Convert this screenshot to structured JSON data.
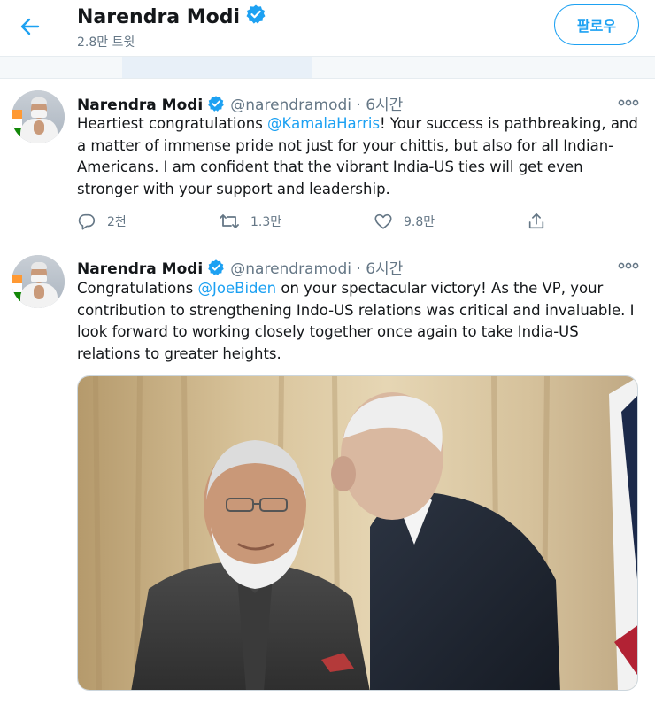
{
  "header": {
    "title": "Narendra Modi",
    "tweet_count": "2.8만 트윗",
    "follow_label": "팔로우"
  },
  "tweets": [
    {
      "name": "Narendra Modi",
      "handle": "@narendramodi",
      "separator": "·",
      "time": "6시간",
      "text_before": "Heartiest congratulations ",
      "mention": "@KamalaHarris",
      "text_after": "! Your success is pathbreaking, and a matter of immense pride not just for your chittis, but also for all Indian-Americans. I am confident that the vibrant India-US ties will get even stronger with your support and leadership.",
      "replies": "2천",
      "retweets": "1.3만",
      "likes": "9.8만"
    },
    {
      "name": "Narendra Modi",
      "handle": "@narendramodi",
      "separator": "·",
      "time": "6시간",
      "text_before": "Congratulations ",
      "mention": "@JoeBiden",
      "text_after": " on your spectacular victory! As the VP, your contribution to strengthening Indo-US relations was critical and invaluable. I look forward to working closely together once again to take India-US relations to greater heights."
    }
  ],
  "icons": {
    "back": "arrow-left-icon",
    "verified": "verified-badge-icon",
    "more": "more-dots-icon",
    "reply": "reply-icon",
    "retweet": "retweet-icon",
    "like": "heart-icon",
    "share": "share-icon"
  },
  "colors": {
    "accent": "#1da1f2",
    "text": "#14171a",
    "muted": "#657786",
    "border": "#e6ecf0"
  }
}
